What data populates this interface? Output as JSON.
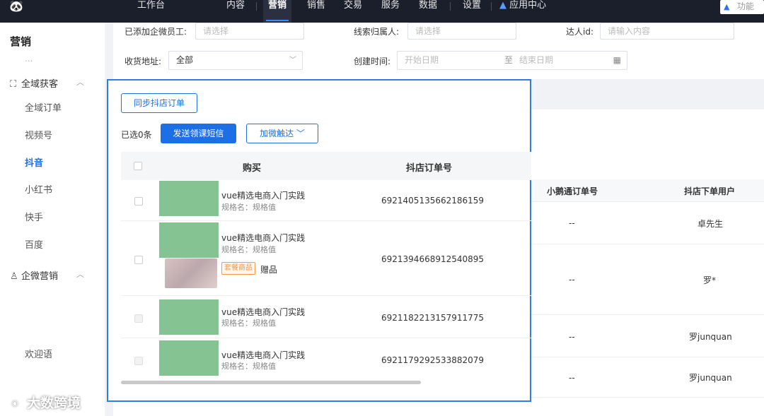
{
  "topnav": {
    "logo_icon": "panda-logo-icon",
    "items": [
      "工作台",
      "内容",
      "营销",
      "销售",
      "交易",
      "服务",
      "数据",
      "设置",
      "应用中心"
    ],
    "active": "营销",
    "search_placeholder": "功能"
  },
  "sidebar": {
    "title": "营销",
    "faded_item": "...",
    "groups": [
      {
        "label": "全域获客",
        "icon": "scan-icon"
      },
      {
        "label": "企微营销",
        "icon": "user-icon"
      }
    ],
    "items": [
      "全域订单",
      "视频号",
      "抖音",
      "小红书",
      "快手",
      "百度",
      "欢迎语"
    ],
    "active_item": "抖音"
  },
  "filters": {
    "wework_staff_label": "已添加企微员工:",
    "wework_staff_placeholder": "请选择",
    "lead_owner_label": "线索归属人:",
    "lead_owner_placeholder": "请选择",
    "influencer_label": "达人id:",
    "influencer_placeholder": "请输入内容",
    "address_label": "收货地址:",
    "address_value": "全部",
    "created_label": "创建时间:",
    "start_placeholder": "开始日期",
    "to_label": "至",
    "end_placeholder": "结束日期"
  },
  "background_table": {
    "headers": [
      "小鹅通订单号",
      "抖店下单用户"
    ],
    "rows": [
      {
        "xet_order": "--",
        "user": "卓先生"
      },
      {
        "xet_order": "--",
        "user": "罗*"
      },
      {
        "xet_order": "--",
        "user": "罗junquan"
      },
      {
        "xet_order": "--",
        "user": "罗junquan"
      }
    ]
  },
  "modal": {
    "sync_button": "同步抖店订单",
    "selected_text": "已选0条",
    "send_sms_button": "发送领课短信",
    "add_wechat_button": "加微触达",
    "headers": {
      "purchase": "购买",
      "order_no": "抖店订单号"
    },
    "rows": [
      {
        "product": "vue精选电商入门实践",
        "spec": "规格名：规格值",
        "order_no": "6921405135662186159"
      },
      {
        "product": "vue精选电商入门实践",
        "spec": "规格名：规格值",
        "order_no": "6921394668912540895",
        "tag": "套餐商品",
        "gift": "赠品"
      },
      {
        "product": "vue精选电商入门实践",
        "spec": "规格名：规格值",
        "order_no": "6921182213157911775"
      },
      {
        "product": "vue精选电商入门实践",
        "spec": "规格名：规格值",
        "order_no": "6921179292533882079"
      }
    ]
  },
  "watermark": "大数跨境",
  "colors": {
    "primary": "#1d6fe6",
    "nav_bg": "#1b1f2b",
    "thumb_green": "#86c393",
    "tag_orange": "#f29a4a"
  }
}
